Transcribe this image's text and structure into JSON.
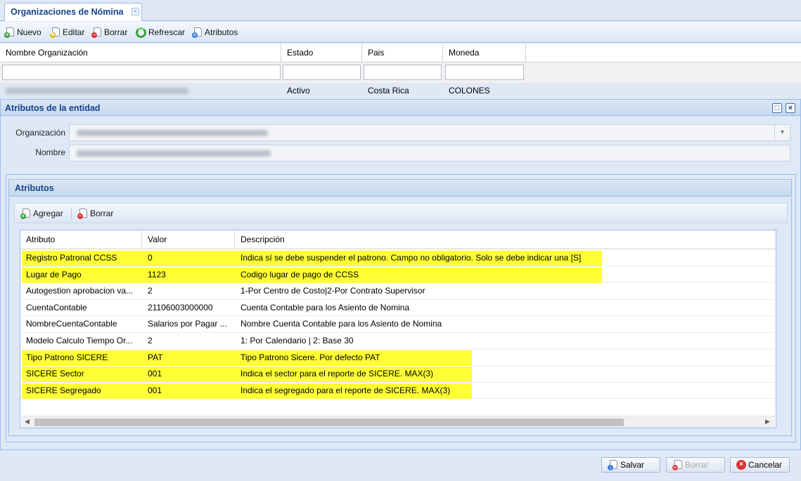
{
  "tab": {
    "label": "Organizaciones de Nómina"
  },
  "toolbar": {
    "nuevo": "Nuevo",
    "editar": "Editar",
    "borrar": "Borrar",
    "refrescar": "Refrescar",
    "atributos": "Atributos"
  },
  "grid": {
    "columns": [
      "Nombre Organización",
      "Estado",
      "Pais",
      "Moneda"
    ],
    "row": {
      "estado": "Activo",
      "pais": "Costa Rica",
      "moneda": "COLONES"
    }
  },
  "panel": {
    "title": "Atributos de la entidad",
    "organizacion_label": "Organización",
    "nombre_label": "Nombre"
  },
  "atributos": {
    "title": "Atributos",
    "agregar": "Agregar",
    "borrar": "Borrar",
    "columns": [
      "Atributo",
      "Valor",
      "Descripción"
    ],
    "rows": [
      {
        "atributo": "Registro Patronal CCSS",
        "valor": "0",
        "descripcion": "Indica sí se debe suspender el patrono. Campo no obligatorio. Solo se debe indicar una [S]",
        "highlight": true
      },
      {
        "atributo": "Lugar de Pago",
        "valor": "1123",
        "descripcion": "Codigo lugar de pago de CCSS",
        "highlight": true
      },
      {
        "atributo": "Autogestion aprobacion va...",
        "valor": "2",
        "descripcion": "1-Por Centro de Costo|2-Por Contrato Supervisor",
        "highlight": false
      },
      {
        "atributo": "CuentaContable",
        "valor": "21106003000000",
        "descripcion": "Cuenta Contable para los Asiento de Nomina",
        "highlight": false
      },
      {
        "atributo": "NombreCuentaContable",
        "valor": "Salarios por Pagar ...",
        "descripcion": "Nombre Cuenta Contable para los Asiento de Nomina",
        "highlight": false
      },
      {
        "atributo": "Modelo Calculo Tiempo Or...",
        "valor": "2",
        "descripcion": "1: Por Calendario | 2: Base 30",
        "highlight": false
      },
      {
        "atributo": "Tipo Patrono SICERE",
        "valor": "PAT",
        "descripcion": "Tipo Patrono Sicere. Por defecto PAT",
        "highlight": true
      },
      {
        "atributo": "SICERE Sector",
        "valor": "001",
        "descripcion": "Indica el sector para el reporte de SICERE. MAX(3)",
        "highlight": true
      },
      {
        "atributo": "SICERE Segregado",
        "valor": "001",
        "descripcion": "Indica el segregado para el reporte de SICERE. MAX(3)",
        "highlight": true
      }
    ]
  },
  "footer": {
    "salvar": "Salvar",
    "borrar": "Borrar",
    "cancelar": "Cancelar"
  },
  "colors": {
    "highlight": "#ffff33",
    "header_text": "#15428b",
    "border": "#99bbe8"
  }
}
